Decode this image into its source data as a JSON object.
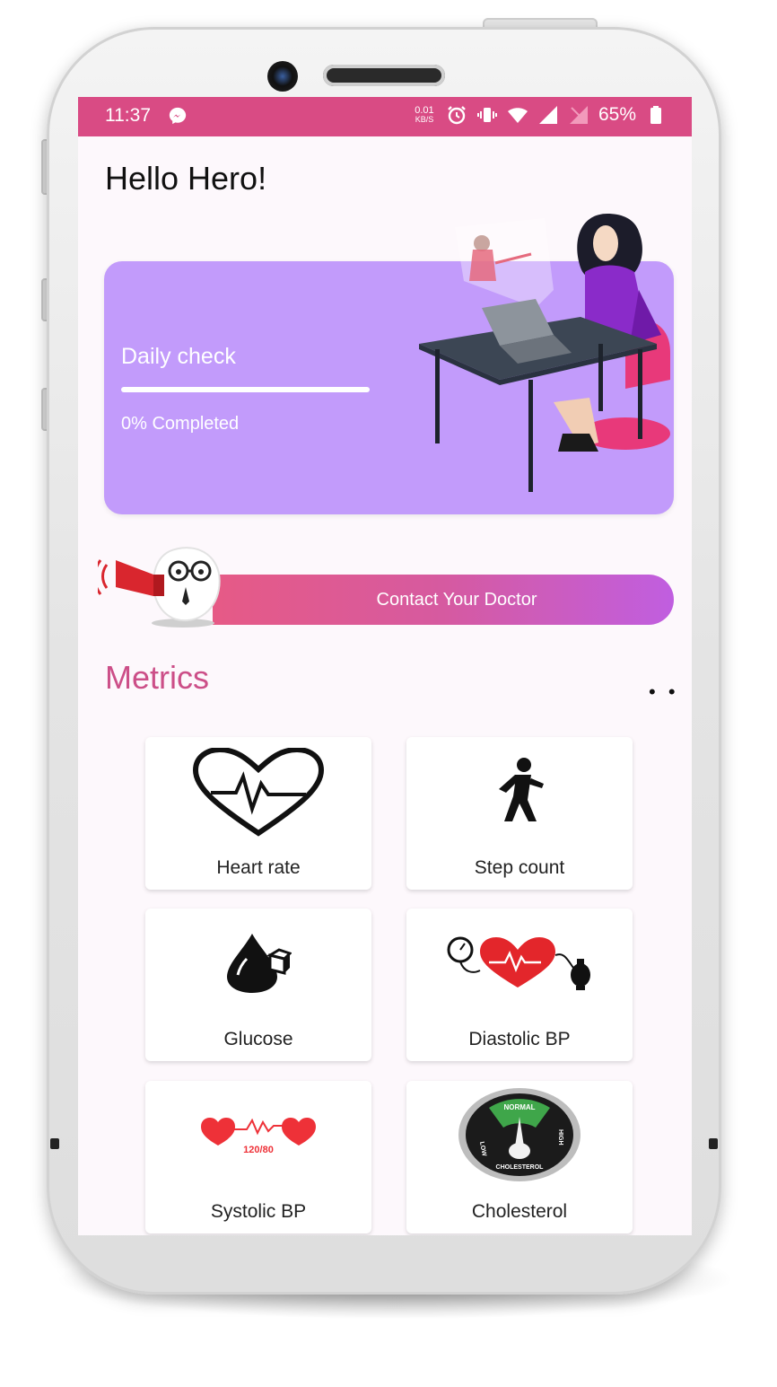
{
  "status_bar": {
    "time": "11:37",
    "net_speed": "0.01",
    "net_unit": "KB/S",
    "battery": "65%"
  },
  "greeting": "Hello Hero!",
  "daily_check": {
    "title": "Daily check",
    "progress_percent": 0,
    "progress_label": "0% Completed"
  },
  "contact": {
    "label": "Contact Your Doctor"
  },
  "metrics": {
    "title": "Metrics",
    "more": "• •",
    "items": [
      {
        "label": "Heart rate",
        "icon": "heart-rate-icon"
      },
      {
        "label": "Step count",
        "icon": "walking-person-icon"
      },
      {
        "label": "Glucose",
        "icon": "glucose-drop-icon"
      },
      {
        "label": "Diastolic BP",
        "icon": "blood-pressure-icon"
      },
      {
        "label": "Systolic BP",
        "icon": "hearts-icon",
        "reading": "120/80"
      },
      {
        "label": "Cholesterol",
        "icon": "cholesterol-gauge-icon",
        "gauge": {
          "top": "NORMAL",
          "left": "LOW",
          "right": "HIGH",
          "bottom": "CHOLESTEROL"
        }
      }
    ]
  },
  "colors": {
    "status_bar": "#d94b84",
    "card_purple": "#c29bfb",
    "metrics_title": "#cc4f88",
    "accent_gradient_start": "#e65a86",
    "accent_gradient_end": "#c05ee0"
  }
}
